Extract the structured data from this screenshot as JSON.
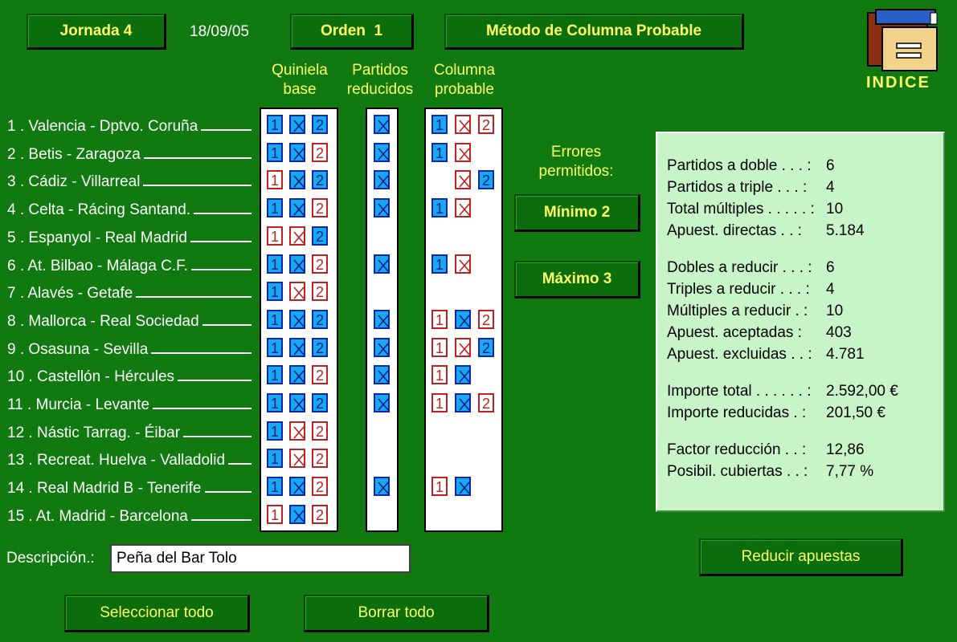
{
  "header": {
    "jornada_label": "Jornada 4",
    "date": "18/09/05",
    "orden_label": "Orden  1",
    "method_label": "Método de Columna Probable",
    "index_label": "INDICE"
  },
  "column_headers": {
    "base": "Quiniela base",
    "reduced": "Partidos reducidos",
    "probable": "Columna probable"
  },
  "matches": [
    {
      "label": "1 . Valencia - Dptvo. Coruña",
      "base": [
        1,
        1,
        1
      ],
      "reduced": true,
      "probable": [
        1,
        0,
        0
      ]
    },
    {
      "label": "2 . Betis - Zaragoza",
      "base": [
        1,
        1,
        0
      ],
      "reduced": true,
      "probable": [
        1,
        0,
        null
      ]
    },
    {
      "label": "3 . Cádiz - Villarreal",
      "base": [
        0,
        1,
        1
      ],
      "reduced": true,
      "probable": [
        null,
        0,
        1
      ]
    },
    {
      "label": "4 . Celta - Rácing Santand.",
      "base": [
        1,
        1,
        0
      ],
      "reduced": true,
      "probable": [
        1,
        0,
        null
      ]
    },
    {
      "label": "5 . Espanyol - Real Madrid",
      "base": [
        0,
        0,
        1
      ],
      "reduced": false,
      "probable": [
        null,
        null,
        null
      ]
    },
    {
      "label": "6 . At. Bilbao - Málaga C.F.",
      "base": [
        1,
        1,
        0
      ],
      "reduced": true,
      "probable": [
        1,
        0,
        null
      ]
    },
    {
      "label": "7 . Alavés - Getafe",
      "base": [
        1,
        0,
        0
      ],
      "reduced": false,
      "probable": [
        null,
        null,
        null
      ]
    },
    {
      "label": "8 . Mallorca - Real Sociedad",
      "base": [
        1,
        1,
        1
      ],
      "reduced": true,
      "probable": [
        0,
        1,
        0
      ]
    },
    {
      "label": "9 . Osasuna - Sevilla",
      "base": [
        1,
        1,
        1
      ],
      "reduced": true,
      "probable": [
        0,
        0,
        1
      ]
    },
    {
      "label": "10 . Castellón - Hércules",
      "base": [
        1,
        1,
        0
      ],
      "reduced": true,
      "probable": [
        0,
        1,
        null
      ]
    },
    {
      "label": "11 . Murcia - Levante",
      "base": [
        1,
        1,
        1
      ],
      "reduced": true,
      "probable": [
        0,
        1,
        0
      ]
    },
    {
      "label": "12 . Nástic Tarrag. - Éibar",
      "base": [
        1,
        0,
        0
      ],
      "reduced": false,
      "probable": [
        null,
        null,
        null
      ]
    },
    {
      "label": "13 . Recreat. Huelva - Valladolid",
      "base": [
        1,
        0,
        0
      ],
      "reduced": false,
      "probable": [
        null,
        null,
        null
      ]
    },
    {
      "label": "14 . Real Madrid B - Tenerife",
      "base": [
        1,
        1,
        0
      ],
      "reduced": true,
      "probable": [
        0,
        1,
        null
      ]
    },
    {
      "label": "15 . At. Madrid - Barcelona",
      "base": [
        0,
        1,
        0
      ],
      "reduced": false,
      "probable": [
        null,
        null,
        null
      ]
    }
  ],
  "errors": {
    "title": "Errores permitidos:",
    "min_label": "Mínimo 2",
    "max_label": "Máximo 3"
  },
  "stats": [
    {
      "label": "Partidos a doble . . . :",
      "value": "6"
    },
    {
      "label": "Partidos a triple . . . :",
      "value": "4"
    },
    {
      "label": "Total múltiples . . . . . :",
      "value": "10"
    },
    {
      "label": "Apuest. directas . . :",
      "value": "5.184"
    },
    {
      "label": "Dobles a reducir . . . :",
      "value": "6"
    },
    {
      "label": "Triples a reducir . . . :",
      "value": "4"
    },
    {
      "label": "Múltiples a reducir . :",
      "value": "10"
    },
    {
      "label": "Apuest. aceptadas :",
      "value": "403"
    },
    {
      "label": "Apuest. excluidas . . :",
      "value": "4.781"
    },
    {
      "label": "Importe total . . . . . . :",
      "value": "2.592,00 €"
    },
    {
      "label": "Importe reducidas . :",
      "value": "201,50 €"
    },
    {
      "label": "Factor reducción . . :",
      "value": "12,86"
    },
    {
      "label": "Posibil. cubiertas . . :",
      "value": "7,77 %"
    }
  ],
  "description": {
    "label": "Descripción.:",
    "value": "Peña del Bar Tolo"
  },
  "buttons": {
    "reduce": "Reducir apuestas",
    "select_all": "Seleccionar todo",
    "clear_all": "Borrar todo"
  },
  "colors": {
    "background": "#107a10",
    "button_text": "#ffff66",
    "cell_on": "#17a9f0",
    "cell_off_border": "#c02020",
    "info_panel": "#c8f5c8"
  }
}
